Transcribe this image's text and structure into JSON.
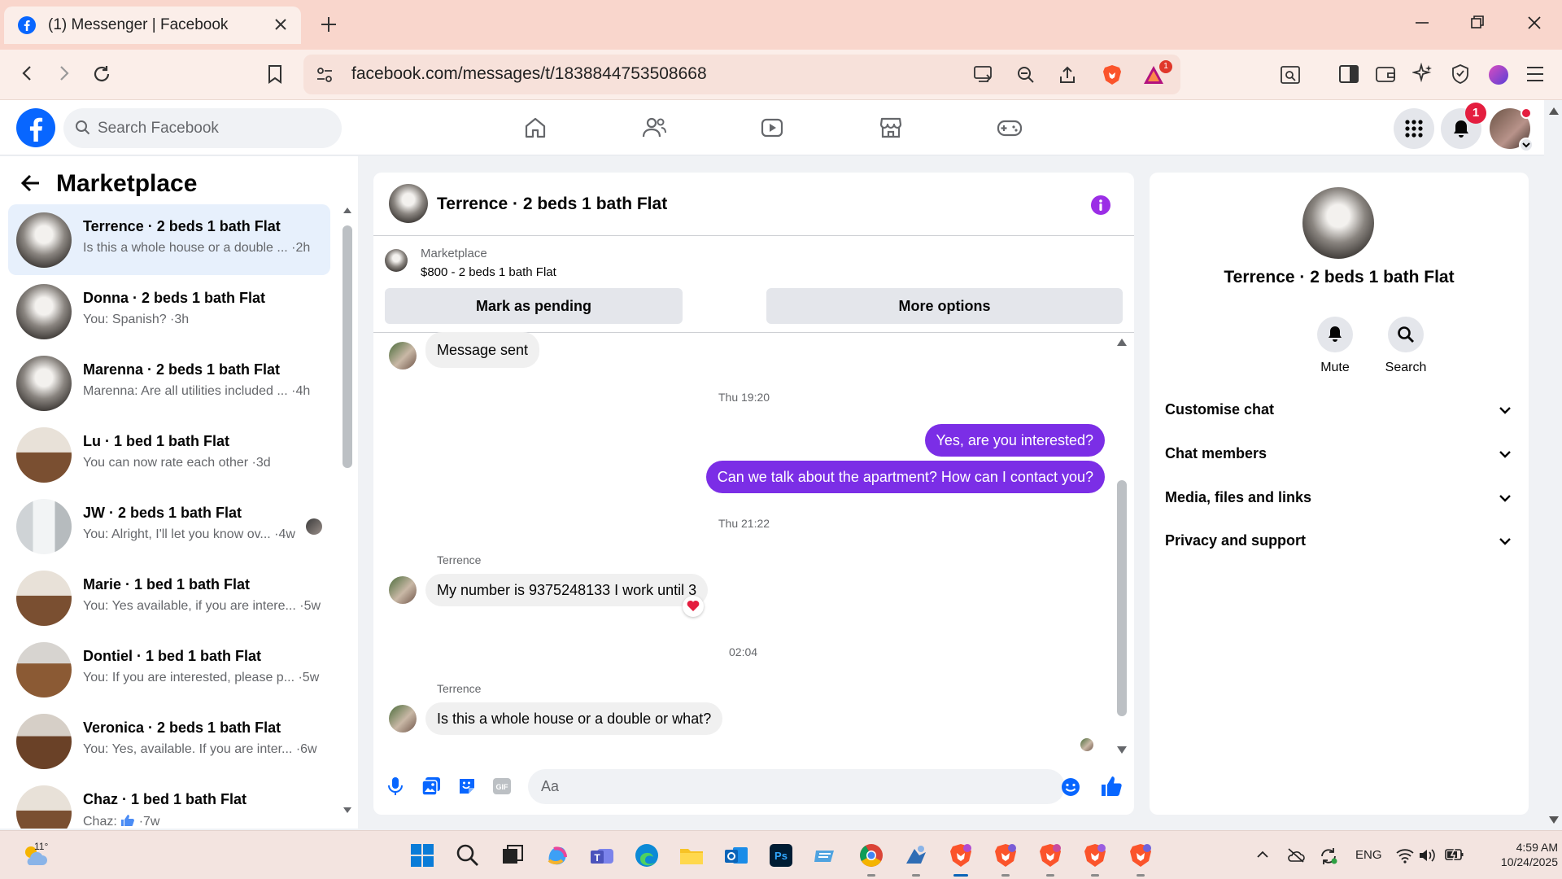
{
  "browser": {
    "tab_title": "(1) Messenger | Facebook",
    "url": "facebook.com/messages/t/1838844753508668",
    "brave_badge": "1"
  },
  "facebook": {
    "search_placeholder": "Search Facebook",
    "notification_count": "1"
  },
  "sidebar": {
    "title": "Marketplace",
    "conversations": [
      {
        "name": "Terrence · 2 beds 1 bath Flat",
        "preview": "Is this a whole house or a double ... ·2h"
      },
      {
        "name": "Donna · 2 beds 1 bath Flat",
        "preview": "You: Spanish? ·3h"
      },
      {
        "name": "Marenna · 2 beds 1 bath Flat",
        "preview": "Marenna: Are all utilities included ... ·4h"
      },
      {
        "name": "Lu · 1 bed 1 bath Flat",
        "preview": "You can now rate each other ·3d"
      },
      {
        "name": "JW · 2 beds 1 bath Flat",
        "preview": "You: Alright, I'll let you know ov... ·4w"
      },
      {
        "name": "Marie · 1 bed 1 bath Flat",
        "preview": "You: Yes available, if you are intere... ·5w"
      },
      {
        "name": "Dontiel · 1 bed 1 bath Flat",
        "preview": "You: If you are interested, please p... ·5w"
      },
      {
        "name": "Veronica · 2 beds 1 bath Flat",
        "preview": "You: Yes, available. If you are inter... ·6w"
      },
      {
        "name": "Chaz · 1 bed 1 bath Flat",
        "preview_prefix": "Chaz: ",
        "preview_suffix": " ·7w"
      }
    ]
  },
  "chat": {
    "title": "Terrence · 2 beds 1 bath Flat",
    "marketplace_label": "Marketplace",
    "listing": "$800 - 2 beds 1 bath Flat",
    "mark_pending": "Mark as pending",
    "more_options": "More options",
    "messages": {
      "m1": "Message sent",
      "ts1": "Thu 19:20",
      "m2": "Yes, are you interested?",
      "m3": "Can we talk about the apartment? How can I contact you?",
      "ts2": "Thu 21:22",
      "sender1": "Terrence",
      "m4": "My number is 9375248133 I work until 3",
      "ts3": "02:04",
      "sender2": "Terrence",
      "m5": "Is this a whole house or a double or what?"
    },
    "input_placeholder": "Aa"
  },
  "details": {
    "name": "Terrence · 2 beds 1 bath Flat",
    "mute": "Mute",
    "search": "Search",
    "sections": [
      "Customise chat",
      "Chat members",
      "Media, files and links",
      "Privacy and support"
    ]
  },
  "taskbar": {
    "temperature": "11°",
    "language": "ENG",
    "time": "4:59 AM",
    "date": "10/24/2025"
  },
  "colors": {
    "fb_blue": "#0866ff",
    "messenger_purple": "#7b2ee6",
    "badge_red": "#e41e3f"
  }
}
